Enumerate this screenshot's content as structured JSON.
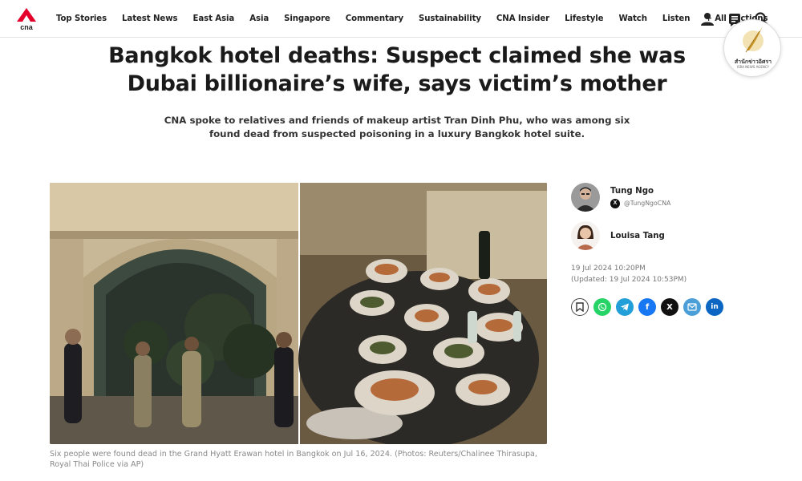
{
  "brand": {
    "logo_text": "cna",
    "accent": "#e4002b"
  },
  "nav": {
    "items": [
      "Top Stories",
      "Latest News",
      "East Asia",
      "Asia",
      "Singapore",
      "Commentary",
      "Sustainability",
      "CNA Insider",
      "Lifestyle",
      "Watch",
      "Listen",
      "+ All Sections"
    ],
    "icons": [
      "user-icon",
      "newsletter-icon",
      "search-icon"
    ]
  },
  "badge": {
    "line1": "สำนักข่าวอิศรา",
    "line2": "ISRA NEWS AGENCY"
  },
  "article": {
    "headline": "Bangkok hotel deaths: Suspect claimed she was Dubai billionaire’s wife, says victim’s mother",
    "standfirst": "CNA spoke to relatives and friends of makeup artist Tran Dinh Phu, who was among six found dead from suspected poisoning in a luxury Bangkok hotel suite.",
    "caption": "Six people were found dead in the Grand Hyatt Erawan hotel in Bangkok on Jul 16, 2024. (Photos: Reuters/Chalinee Thirasupa, Royal Thai Police via AP)"
  },
  "authors": [
    {
      "name": "Tung Ngo",
      "handle": "@TungNgoCNA"
    },
    {
      "name": "Louisa Tang"
    }
  ],
  "dates": {
    "published": "19 Jul 2024 10:20PM",
    "updated": "(Updated: 19 Jul 2024 10:53PM)"
  },
  "share": {
    "buttons": [
      {
        "name": "bookmark-icon",
        "color": "#ffffff"
      },
      {
        "name": "whatsapp-icon",
        "color": "#25d366"
      },
      {
        "name": "telegram-icon",
        "color": "#229ed9"
      },
      {
        "name": "facebook-icon",
        "color": "#1877f2"
      },
      {
        "name": "x-icon",
        "color": "#111111"
      },
      {
        "name": "email-icon",
        "color": "#4a9fd8"
      },
      {
        "name": "linkedin-icon",
        "color": "#0a66c2"
      }
    ]
  }
}
